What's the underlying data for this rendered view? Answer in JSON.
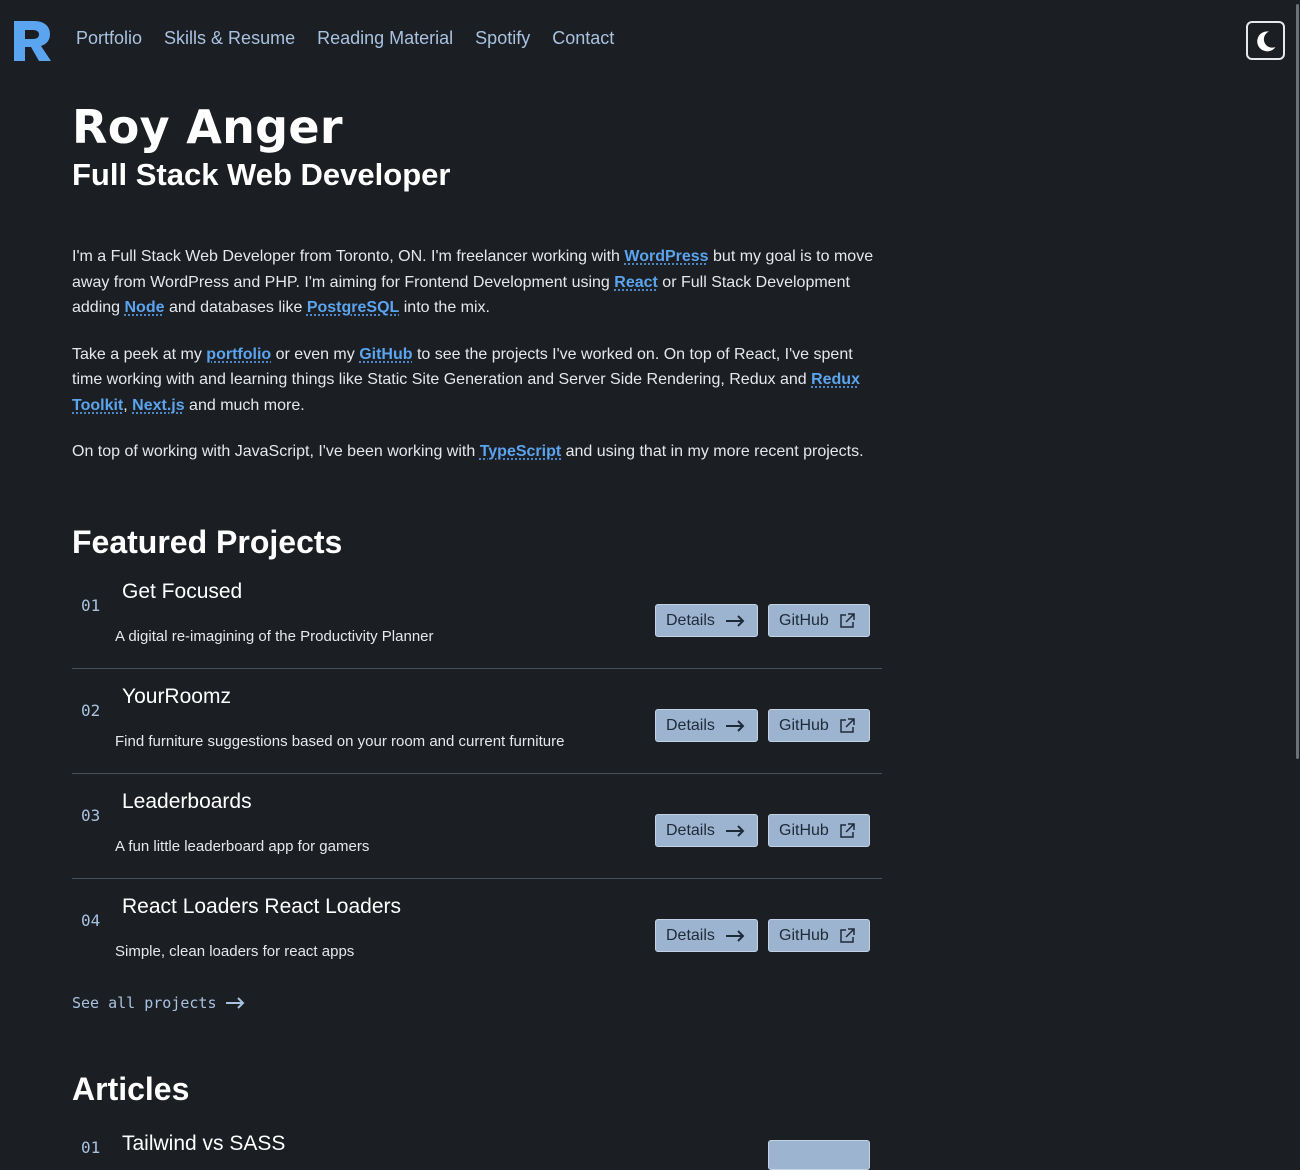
{
  "header": {
    "logo_letter": "R",
    "nav": [
      "Portfolio",
      "Skills & Resume",
      "Reading Material",
      "Spotify",
      "Contact"
    ],
    "theme_toggle_icon": "moon-icon"
  },
  "intro": {
    "name": "Roy Anger",
    "role": "Full Stack Web Developer",
    "p1": {
      "t1": "I'm a Full Stack Web Developer from Toronto, ON. I'm freelancer working with ",
      "l1": "WordPress",
      "t2": " but my goal is to move away from WordPress and PHP. I'm aiming for Frontend Development using ",
      "l2": "React",
      "t3": " or Full Stack Development adding ",
      "l3": "Node",
      "t4": " and databases like ",
      "l4": "PostgreSQL",
      "t5": " into the mix."
    },
    "p2": {
      "t1": "Take a peek at my ",
      "l1": "portfolio",
      "t2": " or even my ",
      "l2": "GitHub",
      "t3": " to see the projects I've worked on. On top of React, I've spent time working with and learning things like Static Site Generation and Server Side Rendering, Redux and ",
      "l3": "Redux Toolkit",
      "t4": ", ",
      "l4": "Next.js",
      "t5": " and much more."
    },
    "p3": {
      "t1": "On top of working with JavaScript, I've been working with ",
      "l1": "TypeScript",
      "t2": " and using that in my more recent projects."
    }
  },
  "featured": {
    "title": "Featured Projects",
    "details_label": "Details",
    "github_label": "GitHub",
    "projects": [
      {
        "num": "01",
        "title": "Get Focused",
        "desc": "A digital re-imagining of the Productivity Planner"
      },
      {
        "num": "02",
        "title": "YourRoomz",
        "desc": "Find furniture suggestions based on your room and current furniture"
      },
      {
        "num": "03",
        "title": "Leaderboards",
        "desc": "A fun little leaderboard app for gamers"
      },
      {
        "num": "04",
        "title": "React Loaders React Loaders",
        "desc": "Simple, clean loaders for react apps"
      }
    ],
    "see_all": "See all projects"
  },
  "articles": {
    "title": "Articles",
    "first": {
      "num": "01",
      "title": "Tailwind vs SASS"
    }
  }
}
